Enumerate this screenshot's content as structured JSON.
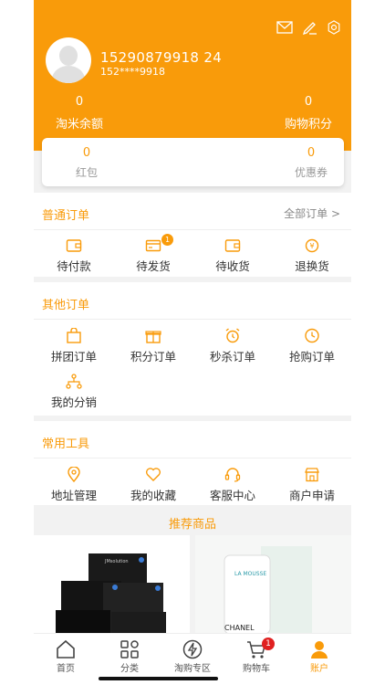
{
  "header": {
    "user_name": "15290879918  24",
    "user_phone": "152****9918",
    "balance": {
      "value": "0",
      "label": "淘米余额"
    },
    "points": {
      "value": "0",
      "label": "购物积分"
    }
  },
  "card": {
    "red_packet": {
      "value": "0",
      "label": "红包"
    },
    "coupon": {
      "value": "0",
      "label": "优惠券"
    }
  },
  "orders": {
    "title": "普通订单",
    "all_link": "全部订单 >",
    "items": [
      {
        "label": "待付款",
        "icon": "wallet-icon"
      },
      {
        "label": "待发货",
        "icon": "card-icon",
        "badge": "1"
      },
      {
        "label": "待收货",
        "icon": "wallet-icon"
      },
      {
        "label": "退换货",
        "icon": "yen-refresh-icon"
      }
    ]
  },
  "other_orders": {
    "title": "其他订单",
    "items": [
      {
        "label": "拼团订单",
        "icon": "shopping-bag-icon"
      },
      {
        "label": "积分订单",
        "icon": "gift-icon"
      },
      {
        "label": "秒杀订单",
        "icon": "alarm-clock-icon"
      },
      {
        "label": "抢购订单",
        "icon": "clock-icon"
      },
      {
        "label": "我的分销",
        "icon": "network-icon"
      }
    ]
  },
  "tools": {
    "title": "常用工具",
    "items": [
      {
        "label": "地址管理",
        "icon": "location-pin-icon"
      },
      {
        "label": "我的收藏",
        "icon": "heart-icon"
      },
      {
        "label": "客服中心",
        "icon": "headset-icon"
      },
      {
        "label": "商户申请",
        "icon": "store-icon"
      }
    ]
  },
  "recommend": {
    "title": "推荐商品",
    "products": [
      {
        "image_text": "JMsolution"
      },
      {
        "image_text": "LA MOUSSE",
        "brand": "CHANEL"
      }
    ]
  },
  "tabbar": {
    "items": [
      {
        "label": "首页",
        "icon": "home-icon"
      },
      {
        "label": "分类",
        "icon": "category-icon"
      },
      {
        "label": "淘购专区",
        "icon": "lightning-icon"
      },
      {
        "label": "购物车",
        "icon": "cart-icon",
        "badge": "1"
      },
      {
        "label": "账户",
        "icon": "account-icon",
        "active": true
      }
    ]
  },
  "colors": {
    "accent": "#f99b0a",
    "badge": "#e02020"
  }
}
